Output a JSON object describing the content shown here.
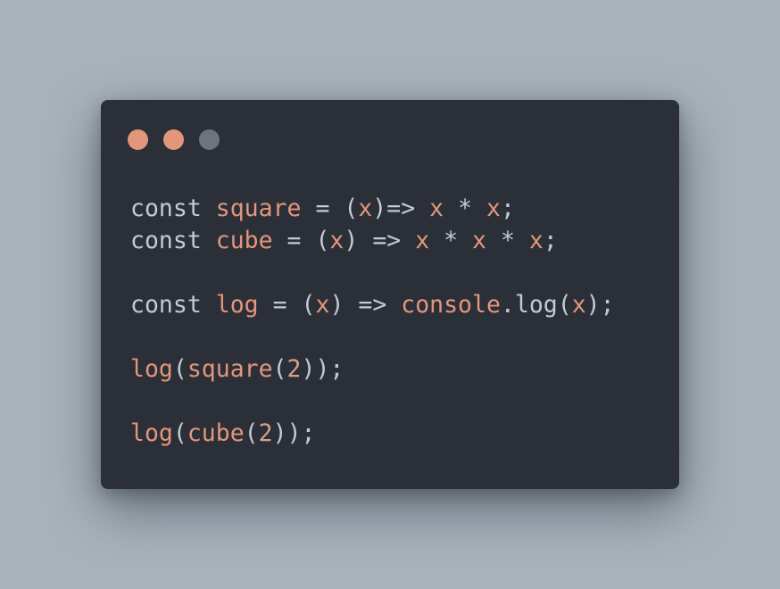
{
  "window": {
    "controls": [
      {
        "name": "close",
        "color": "#e2967c"
      },
      {
        "name": "minimize",
        "color": "#e2967c"
      },
      {
        "name": "maximize",
        "color": "#6f747c"
      }
    ]
  },
  "code": {
    "lines": [
      [
        {
          "t": "const",
          "c": "kw"
        },
        {
          "t": " ",
          "c": "op"
        },
        {
          "t": "square",
          "c": "fn"
        },
        {
          "t": " = ",
          "c": "op"
        },
        {
          "t": "(",
          "c": "punc"
        },
        {
          "t": "x",
          "c": "var"
        },
        {
          "t": ")",
          "c": "punc"
        },
        {
          "t": "=>",
          "c": "op"
        },
        {
          "t": " ",
          "c": "op"
        },
        {
          "t": "x",
          "c": "var"
        },
        {
          "t": " * ",
          "c": "op"
        },
        {
          "t": "x",
          "c": "var"
        },
        {
          "t": ";",
          "c": "punc"
        }
      ],
      [
        {
          "t": "const",
          "c": "kw"
        },
        {
          "t": " ",
          "c": "op"
        },
        {
          "t": "cube",
          "c": "fn"
        },
        {
          "t": " = ",
          "c": "op"
        },
        {
          "t": "(",
          "c": "punc"
        },
        {
          "t": "x",
          "c": "var"
        },
        {
          "t": ")",
          "c": "punc"
        },
        {
          "t": " => ",
          "c": "op"
        },
        {
          "t": "x",
          "c": "var"
        },
        {
          "t": " * ",
          "c": "op"
        },
        {
          "t": "x",
          "c": "var"
        },
        {
          "t": " * ",
          "c": "op"
        },
        {
          "t": "x",
          "c": "var"
        },
        {
          "t": ";",
          "c": "punc"
        }
      ],
      [],
      [
        {
          "t": "const",
          "c": "kw"
        },
        {
          "t": " ",
          "c": "op"
        },
        {
          "t": "log",
          "c": "fn"
        },
        {
          "t": " = ",
          "c": "op"
        },
        {
          "t": "(",
          "c": "punc"
        },
        {
          "t": "x",
          "c": "var"
        },
        {
          "t": ")",
          "c": "punc"
        },
        {
          "t": " => ",
          "c": "op"
        },
        {
          "t": "console",
          "c": "fn"
        },
        {
          "t": ".log(",
          "c": "punc"
        },
        {
          "t": "x",
          "c": "var"
        },
        {
          "t": ");",
          "c": "punc"
        }
      ],
      [],
      [
        {
          "t": "log",
          "c": "fn"
        },
        {
          "t": "(",
          "c": "punc"
        },
        {
          "t": "square",
          "c": "fn"
        },
        {
          "t": "(",
          "c": "punc"
        },
        {
          "t": "2",
          "c": "num"
        },
        {
          "t": "));",
          "c": "punc"
        }
      ],
      [],
      [
        {
          "t": "log",
          "c": "fn"
        },
        {
          "t": "(",
          "c": "punc"
        },
        {
          "t": "cube",
          "c": "fn"
        },
        {
          "t": "(",
          "c": "punc"
        },
        {
          "t": "2",
          "c": "num"
        },
        {
          "t": "));",
          "c": "punc"
        }
      ]
    ]
  }
}
